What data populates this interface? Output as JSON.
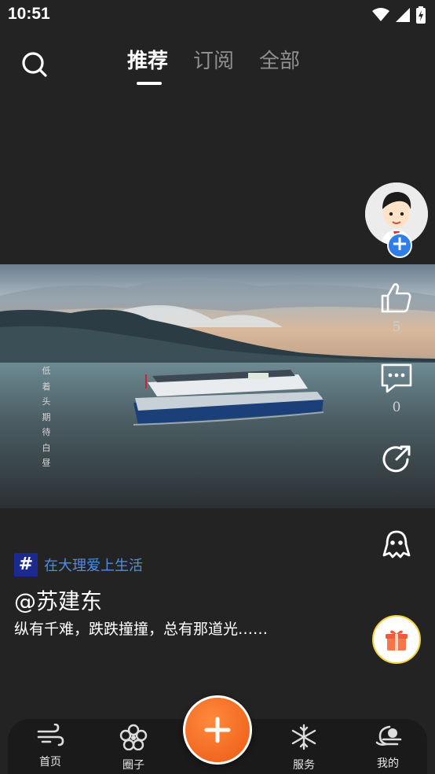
{
  "status_bar": {
    "time": "10:51"
  },
  "top_nav": {
    "tabs": [
      {
        "label": "推荐",
        "active": true
      },
      {
        "label": "订阅",
        "active": false
      },
      {
        "label": "全部",
        "active": false
      }
    ]
  },
  "video": {
    "overlay_text": "低\n着\n头\n期\n待\n白\n昼"
  },
  "side_actions": {
    "like_count": "5",
    "comment_count": "0"
  },
  "post": {
    "topic_badge": "#",
    "topic": "在大理爱上生活",
    "author": "@苏建东",
    "caption": "纵有千难，跌跌撞撞，总有那道光……"
  },
  "bottom_nav": {
    "items": [
      {
        "label": "首页",
        "icon": "wind-icon"
      },
      {
        "label": "圈子",
        "icon": "flower-icon"
      },
      {
        "label": "服务",
        "icon": "snowflake-icon"
      },
      {
        "label": "我的",
        "icon": "moon-icon"
      }
    ]
  },
  "colors": {
    "accent_orange": "#f26820",
    "topic_blue": "#4f8fe3",
    "follow_blue": "#2e7de9"
  }
}
